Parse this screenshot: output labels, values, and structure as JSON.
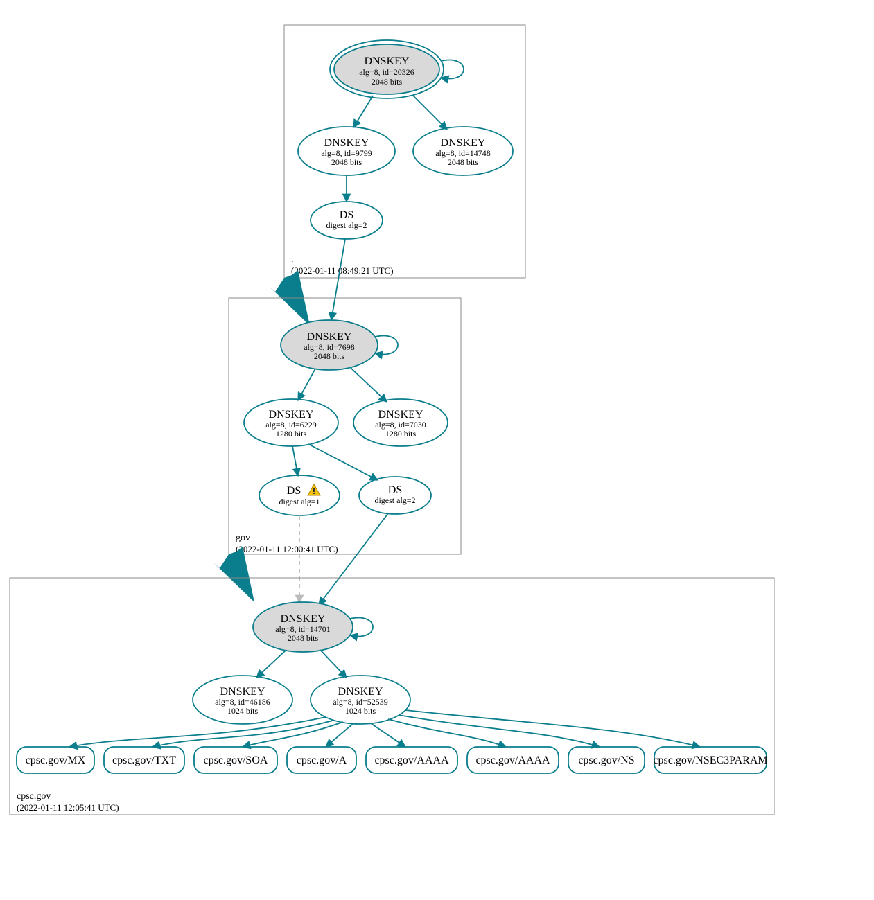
{
  "colors": {
    "stroke": "#0a7e8c",
    "nodeGreyFill": "#d9d9d9",
    "boxStroke": "#888888"
  },
  "zones": {
    "root": {
      "name": ".",
      "ts": "(2022-01-11 08:49:21 UTC)"
    },
    "gov": {
      "name": "gov",
      "ts": "(2022-01-11 12:00:41 UTC)"
    },
    "cpsc": {
      "name": "cpsc.gov",
      "ts": "(2022-01-11 12:05:41 UTC)"
    }
  },
  "nodes": {
    "root_ksk": {
      "title": "DNSKEY",
      "l2": "alg=8, id=20326",
      "l3": "2048 bits"
    },
    "root_zsk1": {
      "title": "DNSKEY",
      "l2": "alg=8, id=9799",
      "l3": "2048 bits"
    },
    "root_zsk2": {
      "title": "DNSKEY",
      "l2": "alg=8, id=14748",
      "l3": "2048 bits"
    },
    "root_ds": {
      "title": "DS",
      "l2": "digest alg=2"
    },
    "gov_ksk": {
      "title": "DNSKEY",
      "l2": "alg=8, id=7698",
      "l3": "2048 bits"
    },
    "gov_zsk1": {
      "title": "DNSKEY",
      "l2": "alg=8, id=6229",
      "l3": "1280 bits"
    },
    "gov_zsk2": {
      "title": "DNSKEY",
      "l2": "alg=8, id=7030",
      "l3": "1280 bits"
    },
    "gov_ds1": {
      "title": "DS",
      "l2": "digest alg=1",
      "warn": true
    },
    "gov_ds2": {
      "title": "DS",
      "l2": "digest alg=2"
    },
    "cpsc_ksk": {
      "title": "DNSKEY",
      "l2": "alg=8, id=14701",
      "l3": "2048 bits"
    },
    "cpsc_zsk1": {
      "title": "DNSKEY",
      "l2": "alg=8, id=46186",
      "l3": "1024 bits"
    },
    "cpsc_zsk2": {
      "title": "DNSKEY",
      "l2": "alg=8, id=52539",
      "l3": "1024 bits"
    }
  },
  "records": {
    "r0": "cpsc.gov/MX",
    "r1": "cpsc.gov/TXT",
    "r2": "cpsc.gov/SOA",
    "r3": "cpsc.gov/A",
    "r4": "cpsc.gov/AAAA",
    "r5": "cpsc.gov/AAAA",
    "r6": "cpsc.gov/NS",
    "r7": "cpsc.gov/NSEC3PARAM"
  }
}
